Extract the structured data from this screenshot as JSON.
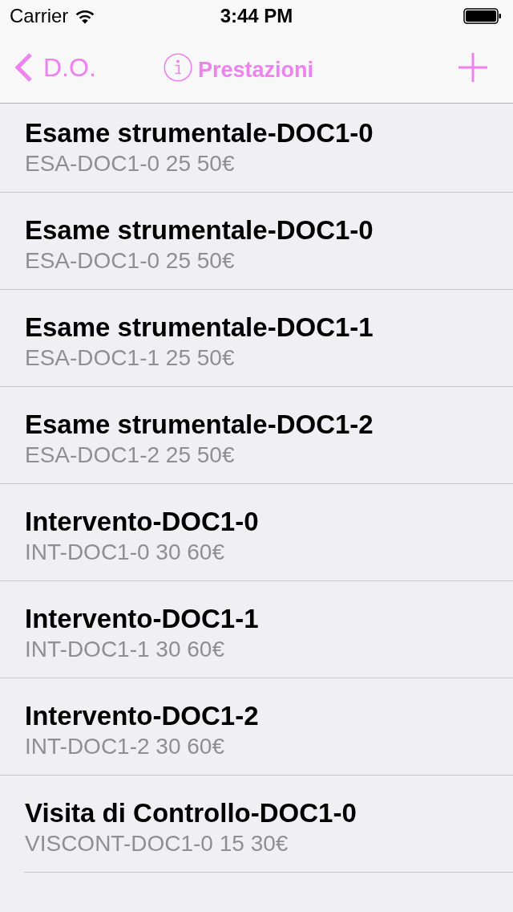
{
  "status_bar": {
    "carrier": "Carrier",
    "time": "3:44 PM"
  },
  "nav_bar": {
    "back_label": "D.O.",
    "title": "Prestazioni"
  },
  "rows": [
    {
      "title": "Esame strumentale-DOC1-0",
      "subtitle": "ESA-DOC1-0 25 50€"
    },
    {
      "title": "Esame strumentale-DOC1-0",
      "subtitle": "ESA-DOC1-0 25 50€"
    },
    {
      "title": "Esame strumentale-DOC1-1",
      "subtitle": "ESA-DOC1-1 25 50€"
    },
    {
      "title": "Esame strumentale-DOC1-2",
      "subtitle": "ESA-DOC1-2 25 50€"
    },
    {
      "title": "Intervento-DOC1-0",
      "subtitle": "INT-DOC1-0 30 60€"
    },
    {
      "title": "Intervento-DOC1-1",
      "subtitle": "INT-DOC1-1 30 60€"
    },
    {
      "title": "Intervento-DOC1-2",
      "subtitle": "INT-DOC1-2 30 60€"
    },
    {
      "title": "Visita di Controllo-DOC1-0",
      "subtitle": "VISCONT-DOC1-0 15 30€"
    }
  ]
}
